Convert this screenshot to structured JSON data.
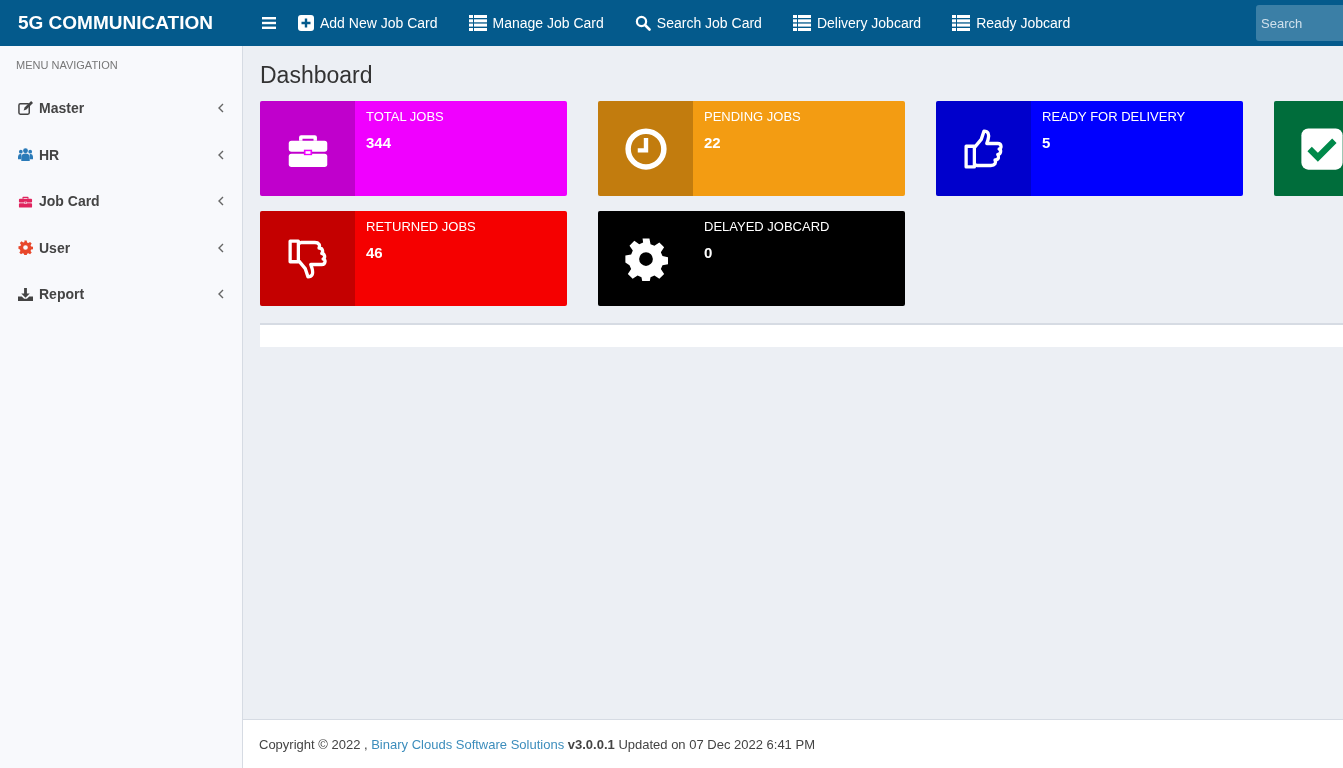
{
  "header": {
    "brand": "5G COMMUNICATION",
    "nav": [
      {
        "label": "Add New Job Card",
        "kind": "plus"
      },
      {
        "label": "Manage Job Card",
        "kind": "list"
      },
      {
        "label": "Search Job Card",
        "kind": "search"
      },
      {
        "label": "Delivery Jobcard",
        "kind": "list"
      },
      {
        "label": "Ready Jobcard",
        "kind": "list"
      }
    ],
    "search": {
      "placeholder": "Search"
    }
  },
  "sidebar": {
    "heading": "MENU NAVIGATION",
    "items": [
      {
        "label": "Master",
        "kind": "edit",
        "color": "#444444"
      },
      {
        "label": "HR",
        "kind": "users",
        "color": "#2a7ab8"
      },
      {
        "label": "Job Card",
        "kind": "briefcase",
        "color": "#e0245e"
      },
      {
        "label": "User",
        "kind": "gear",
        "color": "#e8472b"
      },
      {
        "label": "Report",
        "kind": "download",
        "color": "#444444"
      }
    ]
  },
  "page_title": "Dashboard",
  "cards": [
    {
      "kind": "briefcase",
      "color": "#f000ff",
      "label": "TOTAL JOBS",
      "value": "344"
    },
    {
      "kind": "clock",
      "color": "#f39c12",
      "label": "PENDING JOBS",
      "value": "22"
    },
    {
      "kind": "thumbs-up",
      "color": "#0000ff",
      "label": "READY FOR DELIVERY",
      "value": "5"
    },
    {
      "kind": "check",
      "color": "#00894a"
    },
    {
      "kind": "thumbs-down",
      "color": "#f50000",
      "label": "RETURNED JOBS",
      "value": "46"
    },
    {
      "kind": "gear",
      "color": "#000000",
      "label": "DELAYED JOBCARD",
      "value": "0"
    }
  ],
  "footer": {
    "prefix": "Copyright © 2022 ,",
    "link": "Binary Clouds Software Solutions",
    "suffix": "**v3.0.0.1** Updated on 07 Dec 2022 6:41 PM"
  }
}
